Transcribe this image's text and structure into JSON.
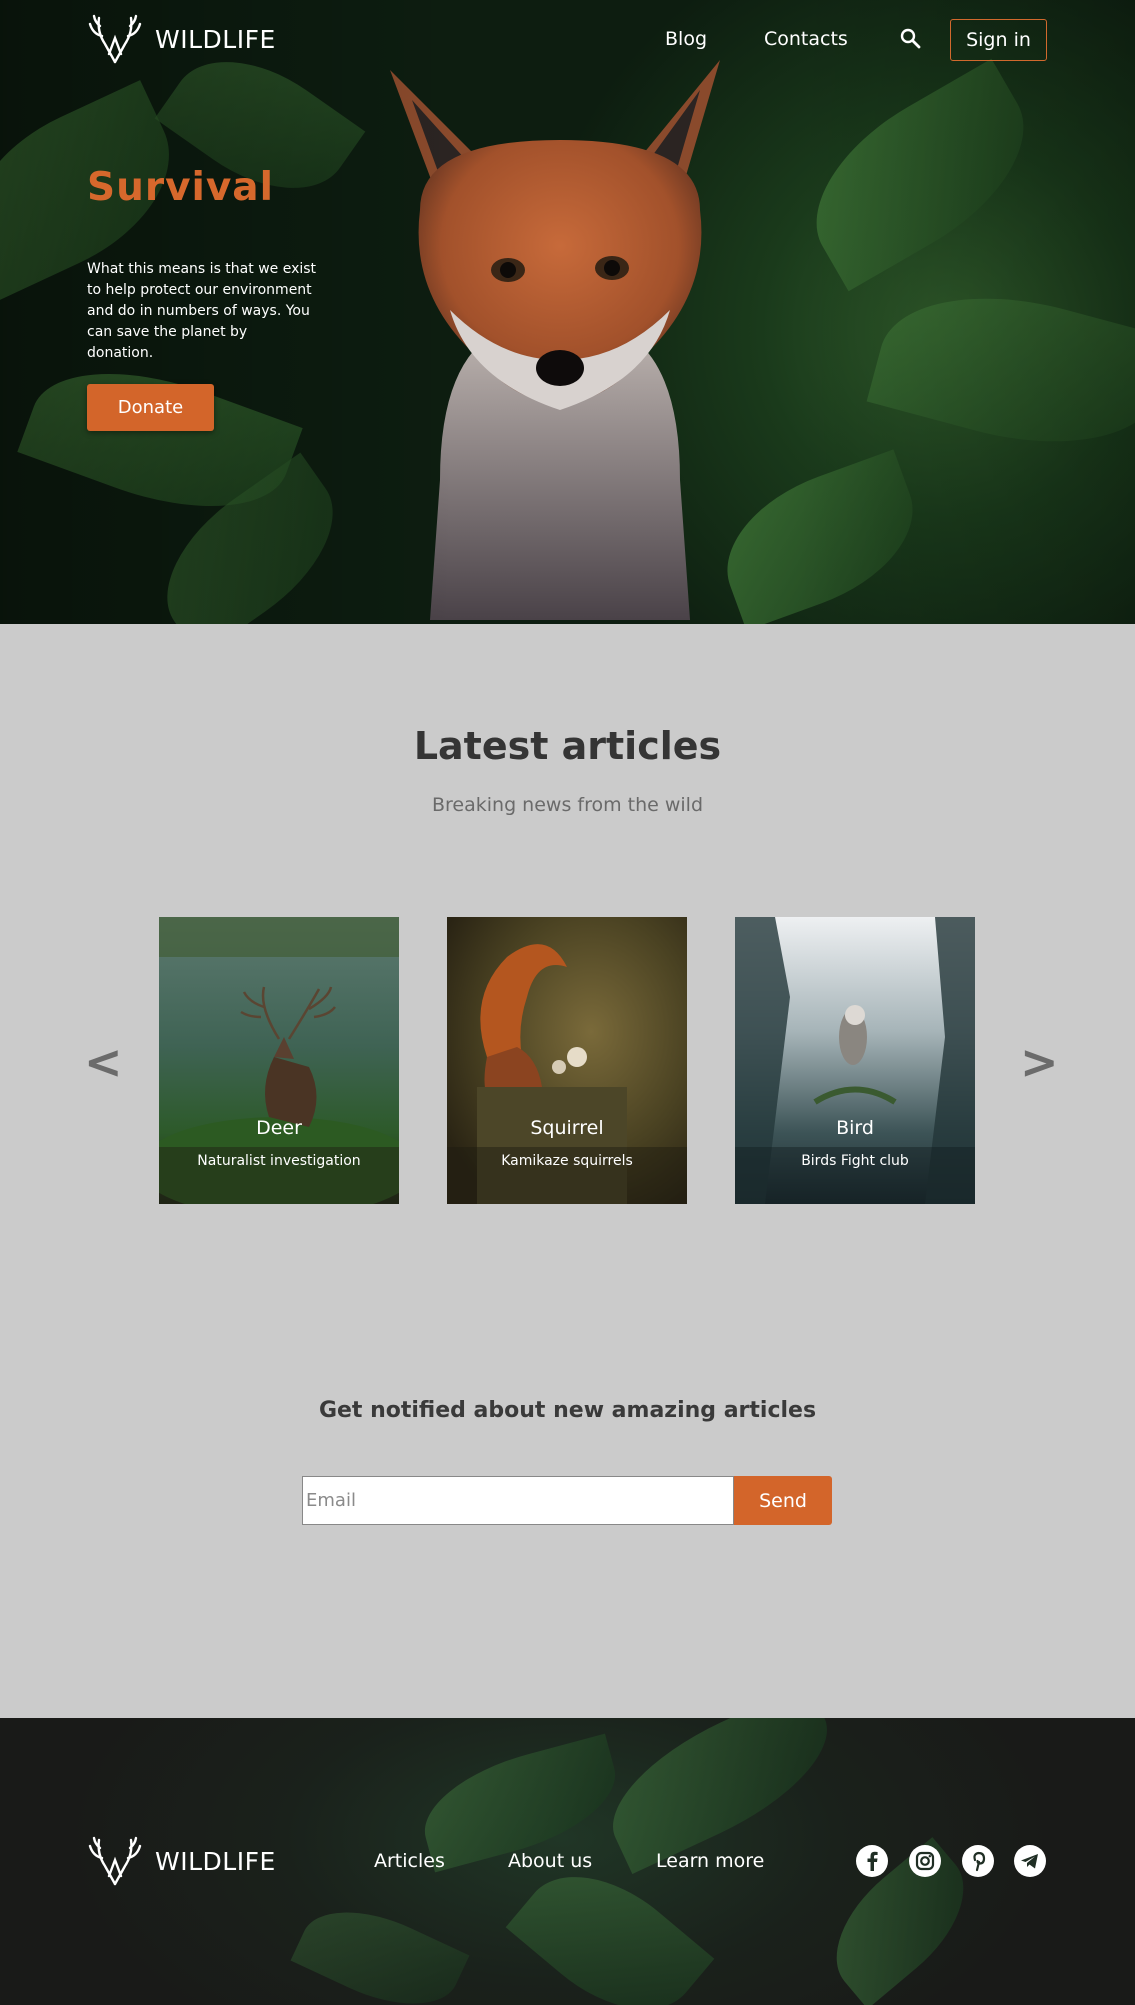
{
  "brand": {
    "name": "WILDLIFE"
  },
  "nav": {
    "blog": "Blog",
    "contacts": "Contacts",
    "search_icon": "search-icon",
    "signin": "Sign in"
  },
  "hero": {
    "title": "Survival",
    "text": "What this means is that we exist to help protect our environment and do in numbers of ways. You can save the planet by donation.",
    "donate": "Donate"
  },
  "articles": {
    "title": "Latest articles",
    "subtitle": "Breaking news from the wild",
    "prev": "<",
    "next": ">",
    "cards": [
      {
        "title": "Deer",
        "subtitle": "Naturalist investigation"
      },
      {
        "title": "Squirrel",
        "subtitle": "Kamikaze squirrels"
      },
      {
        "title": "Bird",
        "subtitle": "Birds Fight club"
      }
    ]
  },
  "newsletter": {
    "title": "Get notified about new amazing articles",
    "email_placeholder": "Email",
    "send": "Send"
  },
  "footer": {
    "brand": "WILDLIFE",
    "links": [
      "Articles",
      "About us",
      "Learn more"
    ],
    "social_icons": [
      "facebook-icon",
      "instagram-icon",
      "pinterest-icon",
      "telegram-icon"
    ]
  },
  "colors": {
    "accent": "#d3652a",
    "page_bg": "#cbcbcb",
    "footer_bg": "#191a18"
  }
}
